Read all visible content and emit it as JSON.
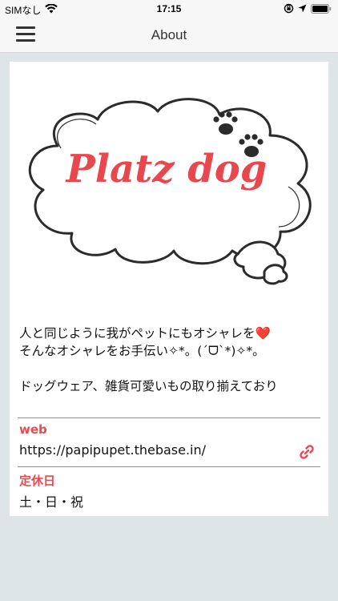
{
  "status_bar": {
    "carrier": "SIMなし",
    "time": "17:15"
  },
  "nav": {
    "title": "About"
  },
  "logo": {
    "text": "Platz dog",
    "color": "#e8474d"
  },
  "about": {
    "description": "人と同じように我がペットにもオシャレを❤️\nそんなオシャレをお手伝い✧*。(ˊᗜˋ*)✧*。\n\nドッグウェア、雑貨可愛いもの取り揃えており"
  },
  "web": {
    "label": "web",
    "url": "https://papipupet.thebase.in/"
  },
  "holiday": {
    "label": "定休日",
    "value": "土・日・祝"
  },
  "colors": {
    "accent": "#e84a50",
    "background": "#dde5e6"
  }
}
